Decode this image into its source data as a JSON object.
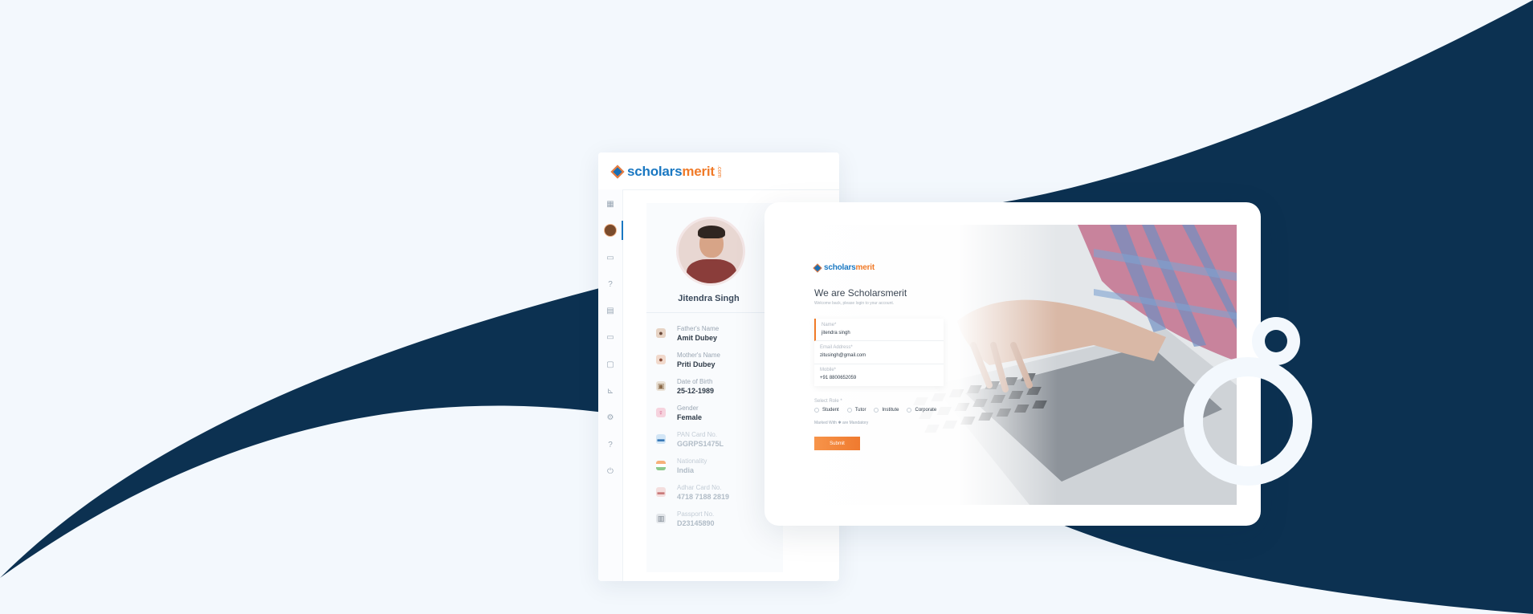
{
  "colors": {
    "background": "#f3f8fd",
    "navy": "#0c3151",
    "brand_blue": "#1a78c2",
    "brand_orange": "#f07a28"
  },
  "app": {
    "logo": {
      "part1": "scholars",
      "part2": "merit",
      "suffix": ".com"
    },
    "sidebar": {
      "items": [
        {
          "icon": "grid-icon"
        },
        {
          "icon": "avatar"
        },
        {
          "icon": "folder-icon"
        },
        {
          "icon": "help-icon"
        },
        {
          "icon": "calendar-icon"
        },
        {
          "icon": "folder-icon"
        },
        {
          "icon": "document-icon"
        },
        {
          "icon": "chart-icon"
        },
        {
          "icon": "settings-icon"
        },
        {
          "icon": "help-icon"
        },
        {
          "icon": "power-icon"
        }
      ]
    },
    "profile": {
      "name": "Jitendra Singh",
      "fields": [
        {
          "label": "Father's Name",
          "value": "Amit Dubey",
          "icon": "user-male-icon"
        },
        {
          "label": "Mother's Name",
          "value": "Priti Dubey",
          "icon": "user-female-icon"
        },
        {
          "label": "Date of Birth",
          "value": "25-12-1989",
          "icon": "cake-icon"
        },
        {
          "label": "Gender",
          "value": "Female",
          "icon": "gender-icon"
        },
        {
          "label": "PAN Card No.",
          "value": "GGRPS1475L",
          "icon": "id-card-icon"
        },
        {
          "label": "Nationality",
          "value": "India",
          "icon": "flag-icon"
        },
        {
          "label": "Adhar Card No.",
          "value": "4718 7188 2819",
          "icon": "id-card-icon"
        },
        {
          "label": "Passport No.",
          "value": "D23145890",
          "icon": "passport-icon"
        }
      ]
    }
  },
  "login": {
    "logo": {
      "part1": "scholars",
      "part2": "merit"
    },
    "title": "We are Scholarsmerit",
    "subtitle": "Welcome back, please login to your account.",
    "fields": [
      {
        "label": "Name*",
        "value": "jitendra singh"
      },
      {
        "label": "Email Address*",
        "value": "zitusingh@gmail.com"
      },
      {
        "label": "Mobile*",
        "value": "+91 8800652059"
      }
    ],
    "role_label": "Select Role *",
    "roles": [
      "Student",
      "Tutor",
      "Institute",
      "Corporate"
    ],
    "mandatory_note": "Marked With ✱ are Mandatory",
    "submit_label": "Submit"
  }
}
